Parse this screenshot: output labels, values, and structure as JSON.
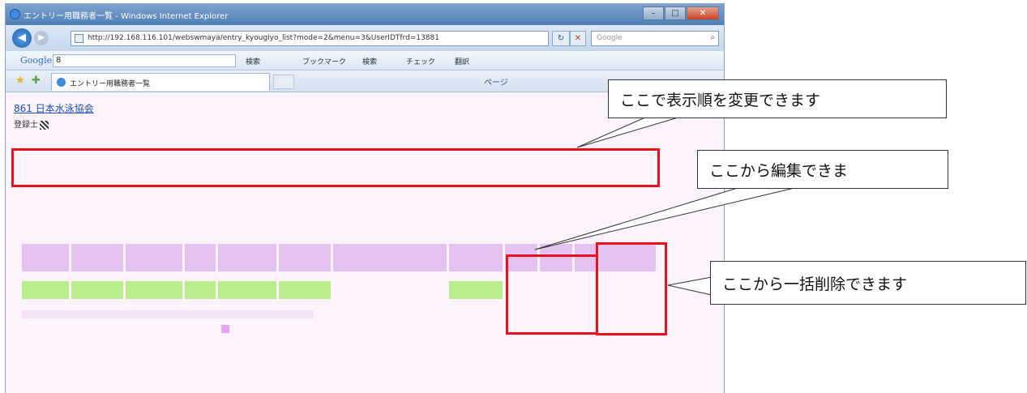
{
  "browser": {
    "title": "エントリー用職務者一覧 - Windows Internet Explorer",
    "url": "http://192.168.116.101/webswmaya/entry_kyougiyo_list?mode=2&menu=3&UserIDTfrd=13881",
    "search_placeholder": "Google",
    "google_logo": "Google",
    "google_query": "8",
    "tab_label": "エントリー用職務者一覧",
    "toolbar_items": [
      "検索",
      "ブックマーク",
      "検索",
      "チェック",
      "翻訳"
    ],
    "tools_text": "ページ"
  },
  "page": {
    "link_text": "861 日本水泳協会",
    "sub_text": "登録士"
  },
  "grid": {
    "headers": [
      "",
      "",
      "",
      "",
      "",
      "",
      "",
      "",
      "",
      "",
      ""
    ],
    "row": [
      "",
      "",
      "",
      "",
      "",
      "",
      "",
      "",
      "",
      "",
      ""
    ]
  },
  "annotations": {
    "callout_sort": "ここで表示順を変更できます",
    "callout_edit": "ここから編集できま",
    "callout_delete": "ここから一括削除できます"
  },
  "colors": {
    "annotation_red": "#e8101a",
    "header_fill": "#e4c2f2",
    "row_fill": "#b9ee8a"
  }
}
